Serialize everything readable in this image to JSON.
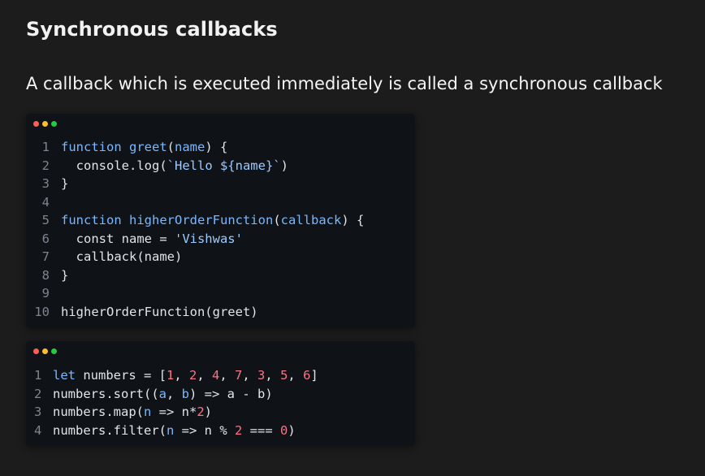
{
  "slide": {
    "title": "Synchronous callbacks",
    "subtitle": "A callback which is executed immediately is called a synchronous callback"
  },
  "colors": {
    "background": "#1c1c1c",
    "code_background": "#0f1217",
    "dot_red": "#ff5f56",
    "dot_yellow": "#ffbd2e",
    "dot_green": "#27c93f",
    "keyword": "#79b8ff",
    "string": "#9ecbff",
    "number": "#f97583",
    "plain": "#e1e4e8",
    "line_number": "#7e8590"
  },
  "code_windows": [
    {
      "window_dots": [
        "red-dot-icon",
        "yellow-dot-icon",
        "green-dot-icon"
      ],
      "lines": [
        {
          "no": "1",
          "tokens": [
            {
              "t": "function ",
              "c": "keyword"
            },
            {
              "t": "greet",
              "c": "keyword"
            },
            {
              "t": "(",
              "c": "plain"
            },
            {
              "t": "name",
              "c": "keyword"
            },
            {
              "t": ") {",
              "c": "plain"
            }
          ]
        },
        {
          "no": "2",
          "tokens": [
            {
              "t": "  console.log(",
              "c": "plain"
            },
            {
              "t": "`Hello ${name}`",
              "c": "string"
            },
            {
              "t": ")",
              "c": "plain"
            }
          ]
        },
        {
          "no": "3",
          "tokens": [
            {
              "t": "}",
              "c": "plain"
            }
          ]
        },
        {
          "no": "4",
          "tokens": []
        },
        {
          "no": "5",
          "tokens": [
            {
              "t": "function ",
              "c": "keyword"
            },
            {
              "t": "higherOrderFunction",
              "c": "keyword"
            },
            {
              "t": "(",
              "c": "plain"
            },
            {
              "t": "callback",
              "c": "keyword"
            },
            {
              "t": ") {",
              "c": "plain"
            }
          ]
        },
        {
          "no": "6",
          "tokens": [
            {
              "t": "  const name = ",
              "c": "plain"
            },
            {
              "t": "'Vishwas'",
              "c": "string"
            }
          ]
        },
        {
          "no": "7",
          "tokens": [
            {
              "t": "  callback(name)",
              "c": "plain"
            }
          ]
        },
        {
          "no": "8",
          "tokens": [
            {
              "t": "}",
              "c": "plain"
            }
          ]
        },
        {
          "no": "9",
          "tokens": []
        },
        {
          "no": "10",
          "tokens": [
            {
              "t": "higherOrderFunction(greet)",
              "c": "plain"
            }
          ]
        }
      ]
    },
    {
      "window_dots": [
        "red-dot-icon",
        "yellow-dot-icon",
        "green-dot-icon"
      ],
      "lines": [
        {
          "no": "1",
          "tokens": [
            {
              "t": "let",
              "c": "keyword"
            },
            {
              "t": " numbers = [",
              "c": "plain"
            },
            {
              "t": "1",
              "c": "number"
            },
            {
              "t": ", ",
              "c": "plain"
            },
            {
              "t": "2",
              "c": "number"
            },
            {
              "t": ", ",
              "c": "plain"
            },
            {
              "t": "4",
              "c": "number"
            },
            {
              "t": ", ",
              "c": "plain"
            },
            {
              "t": "7",
              "c": "number"
            },
            {
              "t": ", ",
              "c": "plain"
            },
            {
              "t": "3",
              "c": "number"
            },
            {
              "t": ", ",
              "c": "plain"
            },
            {
              "t": "5",
              "c": "number"
            },
            {
              "t": ", ",
              "c": "plain"
            },
            {
              "t": "6",
              "c": "number"
            },
            {
              "t": "]",
              "c": "plain"
            }
          ]
        },
        {
          "no": "2",
          "tokens": [
            {
              "t": "numbers.sort((",
              "c": "plain"
            },
            {
              "t": "a",
              "c": "keyword"
            },
            {
              "t": ", ",
              "c": "plain"
            },
            {
              "t": "b",
              "c": "keyword"
            },
            {
              "t": ") => a - b)",
              "c": "plain"
            }
          ]
        },
        {
          "no": "3",
          "tokens": [
            {
              "t": "numbers.map(",
              "c": "plain"
            },
            {
              "t": "n",
              "c": "keyword"
            },
            {
              "t": " => n*",
              "c": "plain"
            },
            {
              "t": "2",
              "c": "number"
            },
            {
              "t": ")",
              "c": "plain"
            }
          ]
        },
        {
          "no": "4",
          "tokens": [
            {
              "t": "numbers.filter(",
              "c": "plain"
            },
            {
              "t": "n",
              "c": "keyword"
            },
            {
              "t": " => n % ",
              "c": "plain"
            },
            {
              "t": "2",
              "c": "number"
            },
            {
              "t": " === ",
              "c": "plain"
            },
            {
              "t": "0",
              "c": "number"
            },
            {
              "t": ")",
              "c": "plain"
            }
          ]
        }
      ]
    }
  ]
}
